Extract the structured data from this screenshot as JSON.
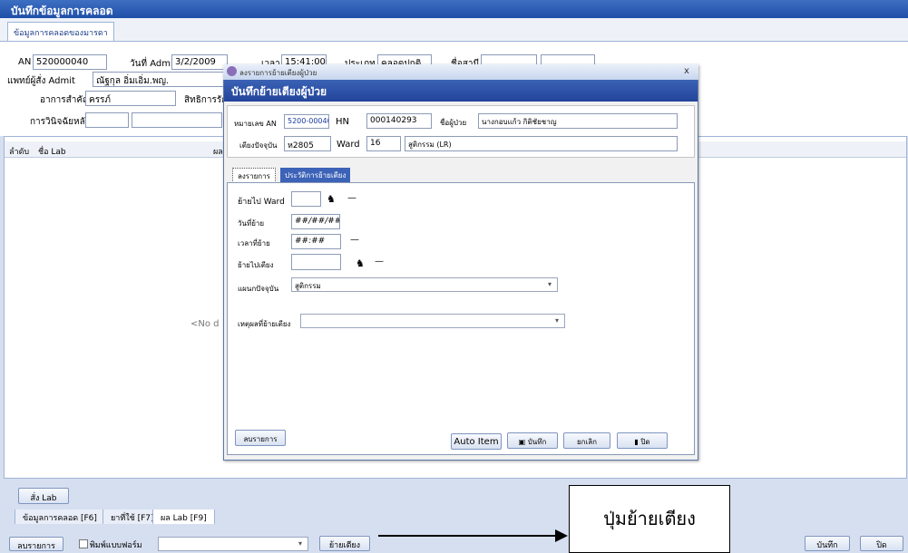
{
  "window": {
    "title": "บันทึกข้อมูลการคลอด"
  },
  "top_tab": "ข้อมูลการคลอดของมารดา",
  "header": {
    "an_label": "AN",
    "an_value": "520000040",
    "admit_date_label": "วันที่ Admit",
    "admit_date_value": "3/2/2009",
    "time_label": "เวลา",
    "time_value": "15:41:00",
    "type_label": "ประเภท",
    "type_value": "คลอดปกติ",
    "spouse_label": "ชื่อสามี",
    "doctor_label": "แพทย์ผู้สั่ง Admit",
    "doctor_value": "ณัฐกุล อิ่มเอิ่ม.พญ.",
    "symptom_label": "อาการสำคัญ",
    "symptom_value": "ครรภ์",
    "rights_label": "สิทธิการรักษ",
    "diagnosis_label": "การวินิจฉัยหลัก"
  },
  "lab_grid": {
    "col_no": "ลำดับ",
    "col_name": "ชื่อ Lab",
    "col_result": "ผล",
    "empty_text": "<No d"
  },
  "buttons": {
    "order_lab": "สั่ง Lab",
    "list": "ลบรายการ",
    "print_form": "พิมพ์แบบฟอร์ม",
    "move_bed": "ย้ายเตียง",
    "save": "บันทึก",
    "close": "ปิด"
  },
  "bottom_tabs": [
    "ข้อมูลการคลอด [F6]",
    "ยาที่ใช้ [F7]",
    "ผล Lab [F9]"
  ],
  "dialog": {
    "window_title": "ลงรายการย้ายเตียงผู้ป่วย",
    "close_glyph": "x",
    "banner": "บันทึกย้ายเตียงผู้ป่วย",
    "an_label": "หมายเลข AN",
    "an_value": "5200-00040",
    "hn_label": "HN",
    "hn_value": "000140293",
    "patient_label": "ชื่อผู้ป่วย",
    "patient_value": "นางกอบแก้ว กิติชัยชาญ",
    "bed_label": "เตียงปัจจุบัน",
    "bed_value": "ห2805",
    "ward_label": "Ward",
    "ward_value": "16",
    "ward_name": "สูติกรรม (LR)",
    "tabs": [
      "ลงรายการ",
      "ประวัติการย้ายเตียง"
    ],
    "move_ward_label": "ย้ายไป Ward",
    "move_date_label": "วันที่ย้าย",
    "move_date_value": "##/##/##",
    "move_time_label": "เวลาที่ย้าย",
    "move_time_value": "##:##",
    "move_bed_label": "ย้ายไปเตียง",
    "dept_label": "แผนกปัจจุบัน",
    "dept_value": "สูติกรรม",
    "reason_label": "เหตุผลที่ย้ายเตียง",
    "dash": "—",
    "btn_list": "ลบรายการ",
    "btn_auto": "Auto Item",
    "btn_save": "บันทึก",
    "btn_cancel": "ยกเลิก",
    "btn_close": "ปิด"
  },
  "callout": {
    "text": "ปุ่มย้ายเตียง"
  },
  "icons": {
    "binoculars": "binoculars-icon",
    "save": "floppy-icon",
    "close": "door-icon",
    "arrow": "arrow-right-icon"
  }
}
